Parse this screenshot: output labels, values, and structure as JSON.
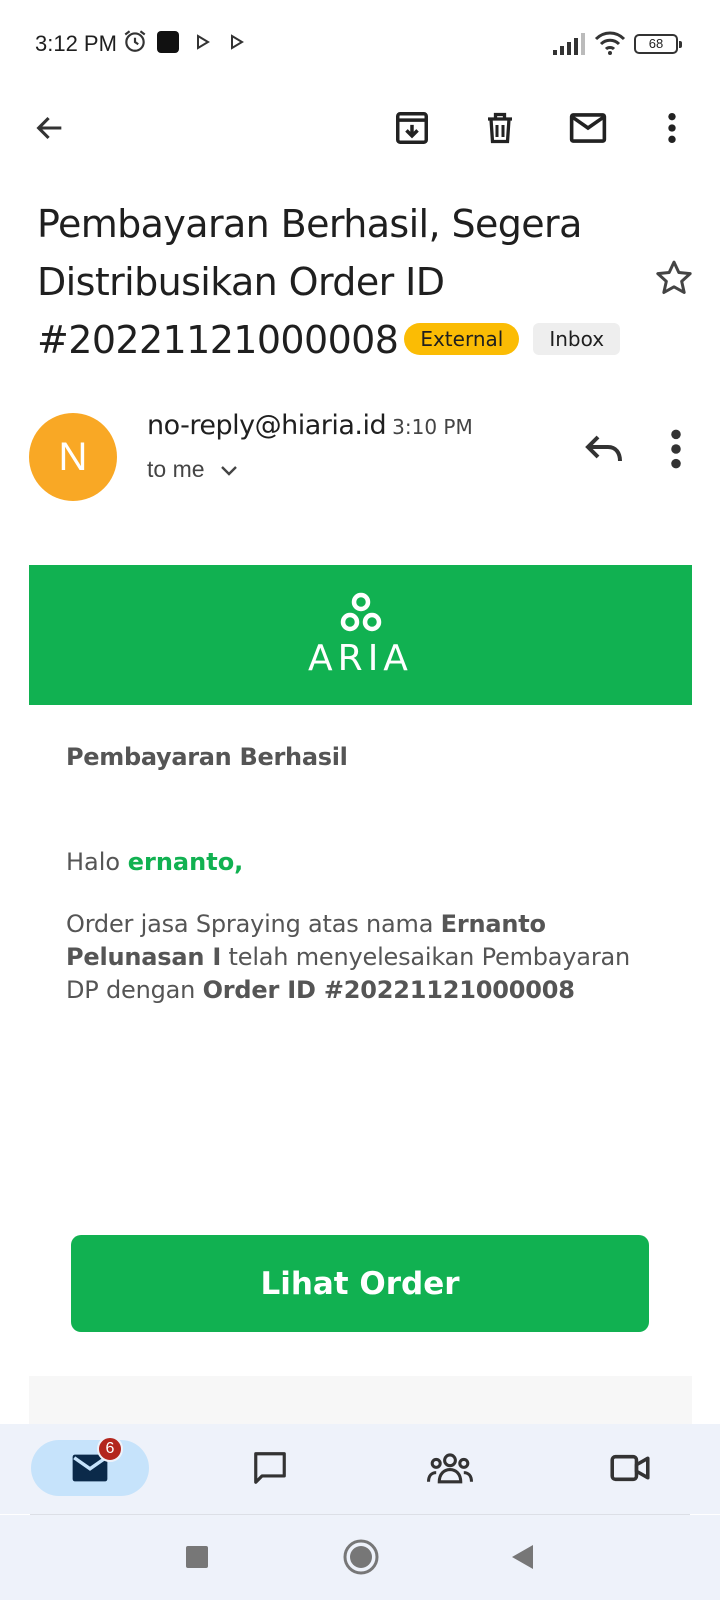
{
  "status_bar": {
    "time": "3:12 PM",
    "battery": "68",
    "icons": [
      "alarm-icon",
      "app-square-icon",
      "play-icon",
      "play-icon",
      "signal-icon",
      "wifi-icon",
      "battery-icon"
    ]
  },
  "toolbar": {
    "icons": [
      "back-arrow-icon",
      "archive-icon",
      "delete-icon",
      "mark-unread-icon",
      "more-vert-icon"
    ]
  },
  "email": {
    "subject_line1": "Pembayaran Berhasil, Segera",
    "subject_line2": "Distribusikan Order ID",
    "subject_line3": "#20221121000008",
    "badge_external": "External",
    "badge_inbox": "Inbox",
    "avatar_letter": "N",
    "sender": "no-reply@hiaria.id",
    "time": "3:10 PM",
    "recipient": "to me"
  },
  "body": {
    "brand": "ARIA",
    "heading": "Pembayaran Berhasil",
    "greeting_prefix": "Halo ",
    "greeting_name": "ernanto,",
    "text_1": "Order jasa Spraying atas nama ",
    "text_bold_name": "Ernanto Pelunasan I",
    "text_2": " telah menyelesaikan Pembayaran DP dengan ",
    "text_bold_order": "Order ID #20221121000008",
    "cta_label": "Lihat Order"
  },
  "bottom_nav": {
    "mail_badge": "6",
    "items": [
      "mail-icon",
      "chat-icon",
      "spaces-icon",
      "meet-icon"
    ]
  },
  "colors": {
    "brand_green": "#11b151",
    "avatar_orange": "#f9a825",
    "badge_yellow": "#fbbc04",
    "nav_active": "#c6e3fb",
    "badge_red": "#b3261e"
  }
}
